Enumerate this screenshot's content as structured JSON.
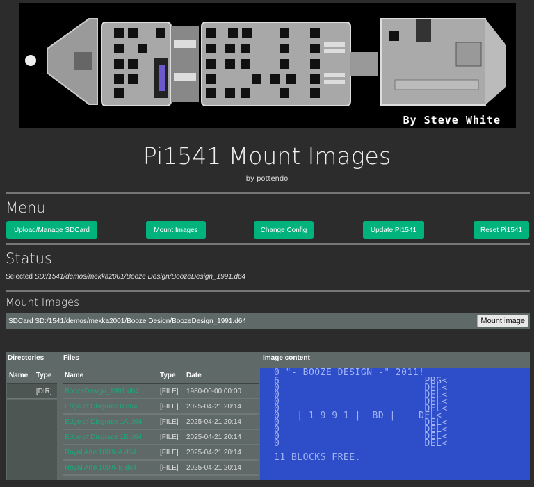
{
  "banner": {
    "credit": "By Steve White"
  },
  "header": {
    "title": "Pi1541 Mount Images",
    "subtitle": "by pottendo"
  },
  "menu": {
    "title": "Menu",
    "buttons": [
      {
        "label": "Upload/Manage SDCard"
      },
      {
        "label": "Mount Images"
      },
      {
        "label": "Change Config"
      },
      {
        "label": "Update Pi1541"
      },
      {
        "label": "Reset Pi1541"
      }
    ]
  },
  "status": {
    "title": "Status",
    "prefix": "Selected ",
    "path": "SD:/1541/demos/mekka2001/Booze Design/BoozeDesign_1991.d64"
  },
  "mount": {
    "title": "Mount Images",
    "path": "SDCard SD:/1541/demos/mekka2001/Booze Design/BoozeDesign_1991.d64",
    "button_label": "Mount image"
  },
  "browser": {
    "directories_heading": "Directories",
    "files_heading": "Files",
    "image_heading": "Image content",
    "dir_columns": [
      "Name",
      "Type"
    ],
    "dirs": [
      {
        "name": "..",
        "type": "[DIR]"
      }
    ],
    "file_columns": [
      "Name",
      "Type",
      "Date"
    ],
    "files": [
      {
        "name": "BoozeDesign_1991.d64",
        "type": "[FILE]",
        "date": "1980-00-00 00:00"
      },
      {
        "name": "Edge of Disgrace 0.d64",
        "type": "[FILE]",
        "date": "2025-04-21 20:14"
      },
      {
        "name": "Edge of Disgrace 1A.d64",
        "type": "[FILE]",
        "date": "2025-04-21 20:14"
      },
      {
        "name": "Edge of Disgrace 1B.d64",
        "type": "[FILE]",
        "date": "2025-04-21 20:14"
      },
      {
        "name": "Royal Arte 100% A.d64",
        "type": "[FILE]",
        "date": "2025-04-21 20:14"
      },
      {
        "name": "Royal Arte 100% B.d64",
        "type": "[FILE]",
        "date": "2025-04-21 20:14"
      }
    ],
    "image_lines": [
      "0 \"- BOOZE DESIGN -\" 2011!",
      "6                         PRG<",
      "0                         DEL<",
      "0                         DEL<",
      "0                         DEL<",
      "0                         DEL<",
      "0   | 1 9 9 1 |  BD |    DEL<",
      "0                         DEL<",
      "0                         DEL<",
      "0                         DEL<",
      "0                         DEL<",
      "11 BLOCKS FREE."
    ]
  },
  "colors": {
    "background": "#2c2c2c",
    "accent": "#00b27c",
    "panel": "#5f6a68",
    "c64_blue": "#2e4dc9",
    "c64_text": "#a3b4f5",
    "link": "#1aab7a"
  }
}
